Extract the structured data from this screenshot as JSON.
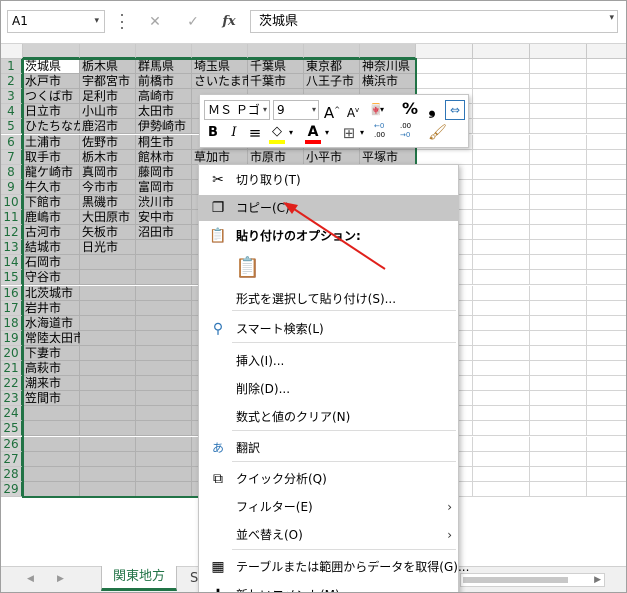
{
  "formula_bar": {
    "name_box": "A1",
    "cancel": "✕",
    "enter": "✓",
    "fx": "fx",
    "value": "茨城県"
  },
  "columns": [
    "A",
    "B",
    "C",
    "D",
    "E",
    "F",
    "G",
    "H",
    "I",
    "J"
  ],
  "row_count": 29,
  "rows": [
    [
      "茨城県",
      "栃木県",
      "群馬県",
      "埼玉県",
      "千葉県",
      "東京都",
      "神奈川県"
    ],
    [
      "水戸市",
      "宇都宮市",
      "前橋市",
      "さいたま市",
      "千葉市",
      "八王子市",
      "横浜市"
    ],
    [
      "つくば市",
      "足利市",
      "高崎市",
      "",
      "",
      "",
      ""
    ],
    [
      "日立市",
      "小山市",
      "太田市",
      "",
      "",
      "",
      ""
    ],
    [
      "ひたちなか市",
      "鹿沼市",
      "伊勢崎市",
      "",
      "",
      "",
      ""
    ],
    [
      "土浦市",
      "佐野市",
      "桐生市",
      "",
      "",
      "",
      ""
    ],
    [
      "取手市",
      "栃木市",
      "館林市",
      "草加市",
      "市原市",
      "小平市",
      "平塚市"
    ],
    [
      "龍ケ崎市",
      "真岡市",
      "藤岡市",
      "",
      "",
      "",
      ""
    ],
    [
      "牛久市",
      "今市市",
      "富岡市",
      "",
      "",
      "",
      ""
    ],
    [
      "下館市",
      "黒磯市",
      "渋川市",
      "",
      "",
      "",
      ""
    ],
    [
      "鹿嶋市",
      "大田原市",
      "安中市",
      "",
      "",
      "",
      ""
    ],
    [
      "古河市",
      "矢板市",
      "沼田市",
      "",
      "",
      "",
      ""
    ],
    [
      "結城市",
      "日光市",
      "",
      "",
      "",
      "",
      ""
    ],
    [
      "石岡市",
      "",
      "",
      "",
      "",
      "",
      ""
    ],
    [
      "守谷市",
      "",
      "",
      "",
      "",
      "",
      ""
    ],
    [
      "北茨城市",
      "",
      "",
      "",
      "",
      "",
      ""
    ],
    [
      "岩井市",
      "",
      "",
      "",
      "",
      "",
      ""
    ],
    [
      "水海道市",
      "",
      "",
      "",
      "",
      "",
      ""
    ],
    [
      "常陸太田市",
      "",
      "",
      "",
      "",
      "",
      ""
    ],
    [
      "下妻市",
      "",
      "",
      "",
      "",
      "",
      ""
    ],
    [
      "高萩市",
      "",
      "",
      "",
      "",
      "",
      ""
    ],
    [
      "潮来市",
      "",
      "",
      "",
      "",
      "",
      ""
    ],
    [
      "笠間市",
      "",
      "",
      "",
      "",
      "",
      ""
    ]
  ],
  "sheet_tabs": {
    "active": "関東地方",
    "next": "S"
  },
  "mini_toolbar": {
    "font_name": "ＭＳ Ｐゴ",
    "font_size": "9",
    "grow": "A",
    "shrink": "A",
    "percent": "%",
    "comma": "❟",
    "bold": "B",
    "italic": "I",
    "align": "≡",
    "fill_letter": "◇",
    "font_color_letter": "A",
    "dec_inc_top": "←0",
    "dec_inc_bottom": ".00",
    "dec_dec_top": ".00",
    "dec_dec_bottom": "→0",
    "accent_fill": "#ffff00",
    "accent_font": "#ff0000"
  },
  "context_menu": {
    "items": [
      {
        "label": "切り取り(T)",
        "icon": "✂"
      },
      {
        "label": "コピー(C)",
        "icon": "❐"
      },
      {
        "label": "貼り付けのオプション:",
        "icon": "📋"
      },
      {
        "label": "形式を選択して貼り付け(S)...",
        "icon": ""
      },
      {
        "label": "スマート検索(L)",
        "icon": "⚲"
      },
      {
        "label": "挿入(I)...",
        "icon": ""
      },
      {
        "label": "削除(D)...",
        "icon": ""
      },
      {
        "label": "数式と値のクリア(N)",
        "icon": ""
      },
      {
        "label": "翻訳",
        "icon": "あ"
      },
      {
        "label": "クイック分析(Q)",
        "icon": "⧉"
      },
      {
        "label": "フィルター(E)",
        "icon": ""
      },
      {
        "label": "並べ替え(O)",
        "icon": ""
      },
      {
        "label": "テーブルまたは範囲からデータを取得(G)...",
        "icon": "▦"
      },
      {
        "label": "新しいコメント(M)",
        "icon": "✚"
      }
    ],
    "submenu_arrow": "›"
  },
  "colors": {
    "excel_green": "#217346",
    "selection_gray": "#c6c6c6",
    "arrow_red": "#e0201b"
  }
}
